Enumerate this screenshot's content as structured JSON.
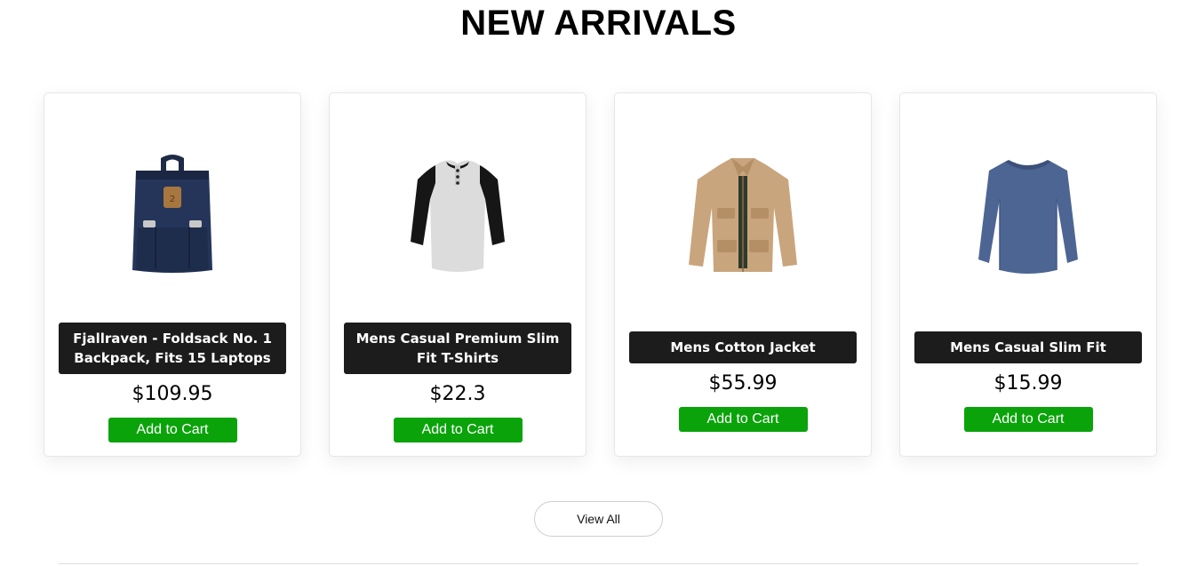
{
  "section": {
    "title": "NEW ARRIVALS"
  },
  "products": [
    {
      "title": "Fjallraven - Foldsack No. 1 Backpack, Fits 15 Laptops",
      "price": "$109.95",
      "cta": "Add to Cart",
      "image_icon": "backpack-icon"
    },
    {
      "title": "Mens Casual Premium Slim Fit T-Shirts",
      "price": "$22.3",
      "cta": "Add to Cart",
      "image_icon": "tshirt-icon"
    },
    {
      "title": "Mens Cotton Jacket",
      "price": "$55.99",
      "cta": "Add to Cart",
      "image_icon": "jacket-icon"
    },
    {
      "title": "Mens Casual Slim Fit",
      "price": "$15.99",
      "cta": "Add to Cart",
      "image_icon": "longsleeve-icon"
    }
  ],
  "view_all_label": "View All",
  "colors": {
    "cta": "#0aa30a",
    "title_bg": "#1c1c1c"
  }
}
